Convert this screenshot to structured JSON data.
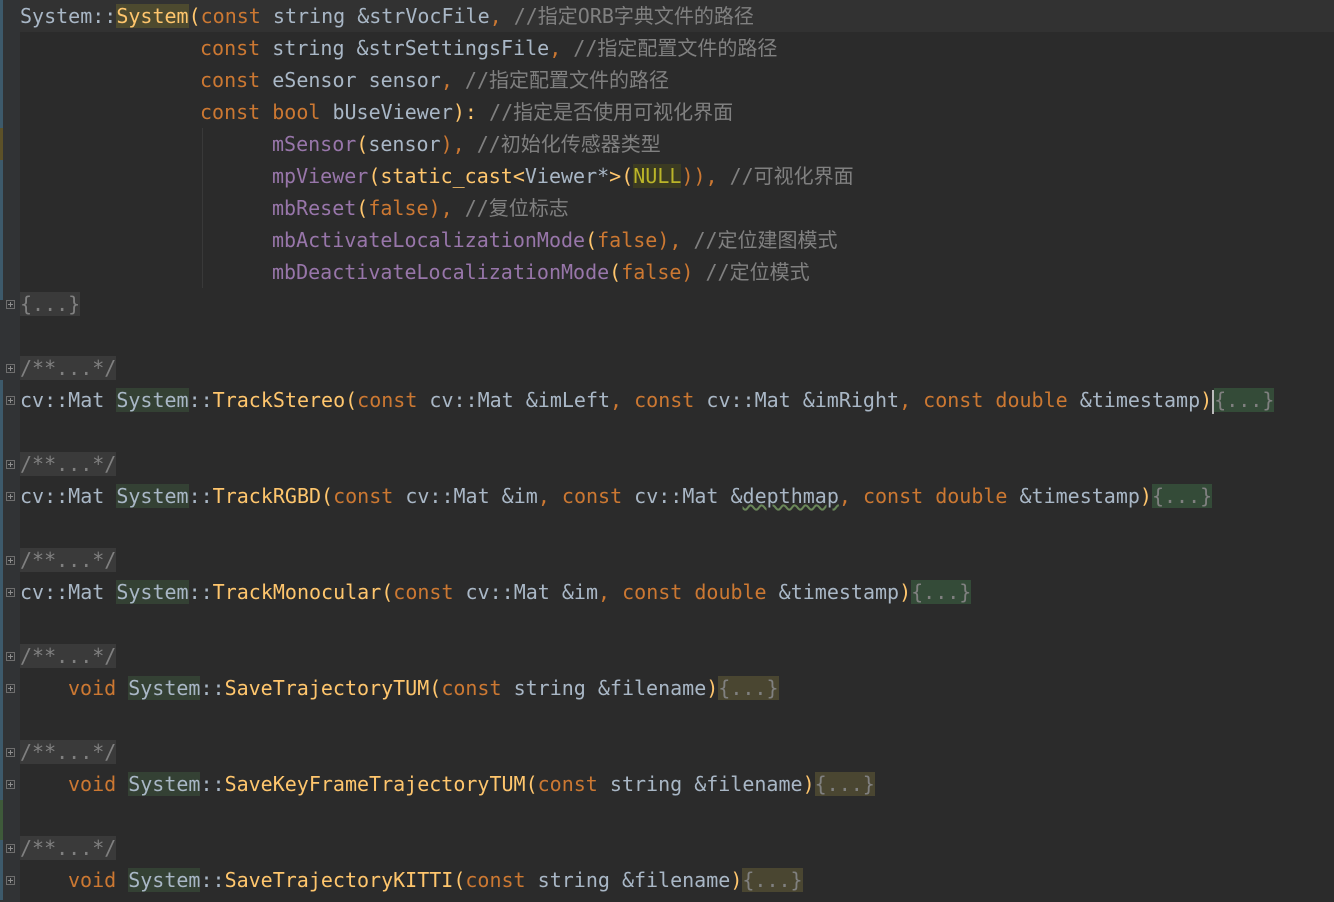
{
  "colors": {
    "background": "#2b2b2b",
    "keyword": "#cc7832",
    "function": "#ffc66d",
    "member": "#9876aa",
    "comment": "#808080",
    "text": "#a9b7c6"
  },
  "icons": {
    "fold": "plus-square-icon"
  },
  "code": {
    "l1": {
      "sys": "System",
      "sep": "::",
      "ctor": "System",
      "open": "(",
      "kw": "const",
      "rest": " string &strVocFile",
      "comma": ",",
      "cmt": " //指定ORB字典文件的路径"
    },
    "l2": {
      "kw": "const",
      "rest": " string &strSettingsFile",
      "comma": ",",
      "cmt": " //指定配置文件的路径"
    },
    "l3": {
      "kw": "const",
      "type": " eSensor",
      "rest": " sensor",
      "comma": ",",
      "cmt": " //指定配置文件的路径"
    },
    "l4": {
      "kw": "const",
      "type": " bool",
      "rest": " bUseViewer",
      "close": "):",
      "cmt": " //指定是否使用可视化界面"
    },
    "l5": {
      "mem": "mSensor",
      "open": "(",
      "arg": "sensor",
      "close": "),",
      "cmt": " //初始化传感器类型"
    },
    "l6": {
      "mem": "mpViewer",
      "open": "(",
      "cast": "static_cast",
      "lt": "<",
      "tmpl": "Viewer*",
      "gt": ">",
      "paren": "(",
      "null": "NULL",
      "close": ")),",
      "cmt": " //可视化界面"
    },
    "l7": {
      "mem": "mbReset",
      "open": "(",
      "arg": "false",
      "close": "),",
      "cmt": " //复位标志"
    },
    "l8": {
      "mem": "mbActivateLocalizationMode",
      "open": "(",
      "arg": "false",
      "close": "),",
      "cmt": " //定位建图模式"
    },
    "l9": {
      "mem": "mbDeactivateLocalizationMode",
      "open": "(",
      "arg": "false",
      "close": ")",
      "cmt": " //定位模式"
    },
    "l10": {
      "folded": "{...}"
    },
    "l12": {
      "doc": "/**...*/"
    },
    "l13": {
      "ret": "cv::Mat ",
      "sys": "System",
      "sep": "::",
      "fn": "TrackStereo",
      "open": "(",
      "k1": "const",
      "p1": " cv::Mat &imLeft",
      "c1": ", ",
      "k2": "const",
      "p2": " cv::Mat &imRight",
      "c2": ", ",
      "k3": "const double",
      "p3": " &timestamp",
      "close": ")",
      "folded": "{...}"
    },
    "l15": {
      "doc": "/**...*/"
    },
    "l16": {
      "ret": "cv::Mat ",
      "sys": "System",
      "sep": "::",
      "fn": "TrackRGBD",
      "open": "(",
      "k1": "const",
      "p1": " cv::Mat &im",
      "c1": ", ",
      "k2": "const",
      "p2a": " cv::Mat &",
      "p2b": "depthmap",
      "c2": ", ",
      "k3": "const double",
      "p3": " &timestamp",
      "close": ")",
      "folded": "{...}"
    },
    "l18": {
      "doc": "/**...*/"
    },
    "l19": {
      "ret": "cv::Mat ",
      "sys": "System",
      "sep": "::",
      "fn": "TrackMonocular",
      "open": "(",
      "k1": "const",
      "p1": " cv::Mat &im",
      "c1": ", ",
      "k2": "const double",
      "p2": " &timestamp",
      "close": ")",
      "folded": "{...}"
    },
    "l21": {
      "doc": "/**...*/"
    },
    "l22": {
      "ret": "void",
      "sys": "System",
      "sep": "::",
      "fn": "SaveTrajectoryTUM",
      "open": "(",
      "k1": "const",
      "p1": " string &filename",
      "close": ")",
      "folded": "{...}"
    },
    "l24": {
      "doc": "/**...*/"
    },
    "l25": {
      "ret": "void",
      "sys": "System",
      "sep": "::",
      "fn": "SaveKeyFrameTrajectoryTUM",
      "open": "(",
      "k1": "const",
      "p1": " string &filename",
      "close": ")",
      "folded": "{...}"
    },
    "l27": {
      "doc": "/**...*/"
    },
    "l28": {
      "ret": "void",
      "sys": "System",
      "sep": "::",
      "fn": "SaveTrajectoryKITTI",
      "open": "(",
      "k1": "const",
      "p1": " string &filename",
      "close": ")",
      "folded": "{...}"
    }
  }
}
